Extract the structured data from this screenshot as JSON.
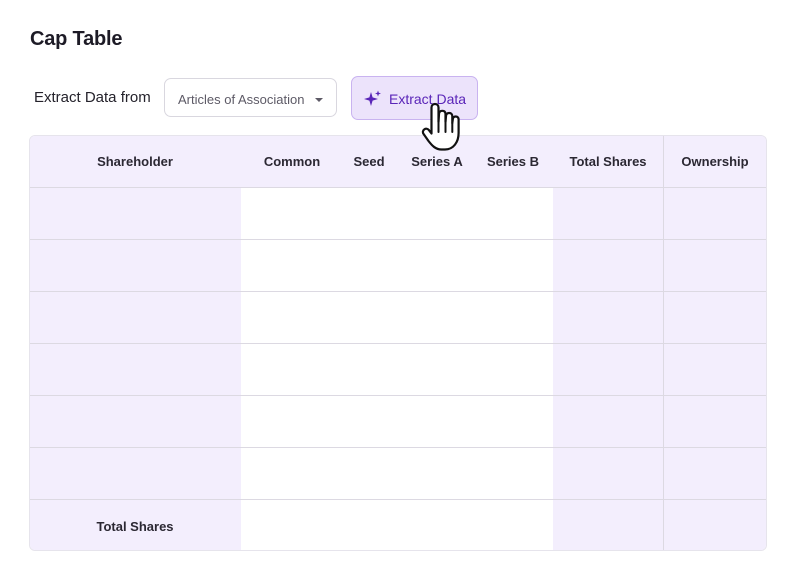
{
  "page": {
    "title": "Cap Table"
  },
  "toolbar": {
    "extract_label": "Extract Data from",
    "source_select": {
      "value": "Articles of Association"
    },
    "extract_button": {
      "label": "Extract Data",
      "icon": "sparkle-icon"
    }
  },
  "table": {
    "columns": [
      "Shareholder",
      "Common",
      "Seed",
      "Series A",
      "Series B",
      "Total Shares",
      "Ownership"
    ],
    "rows": [
      [
        "",
        "",
        "",
        "",
        "",
        "",
        ""
      ],
      [
        "",
        "",
        "",
        "",
        "",
        "",
        ""
      ],
      [
        "",
        "",
        "",
        "",
        "",
        "",
        ""
      ],
      [
        "",
        "",
        "",
        "",
        "",
        "",
        ""
      ],
      [
        "",
        "",
        "",
        "",
        "",
        "",
        ""
      ],
      [
        "",
        "",
        "",
        "",
        "",
        "",
        ""
      ]
    ],
    "footer_label": "Total Shares"
  },
  "colors": {
    "accent": "#5a25b8",
    "accent_bg": "#ece3fb",
    "highlight_column_bg": "#f3eefd"
  }
}
